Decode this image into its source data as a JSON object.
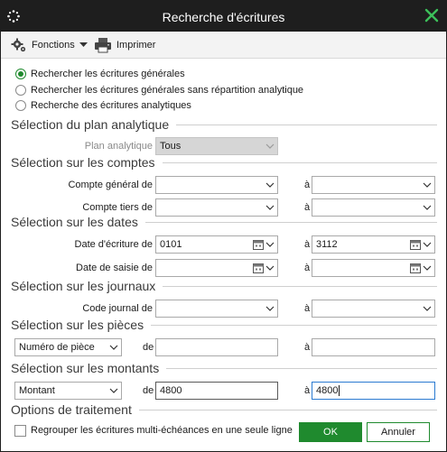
{
  "window": {
    "title": "Recherche d'écritures",
    "app_icon": "dotted-circle-icon",
    "close_icon": "close-x-icon"
  },
  "toolbar": {
    "functions_label": "Fonctions",
    "functions_icon": "gear-icon",
    "print_label": "Imprimer",
    "print_icon": "printer-icon"
  },
  "search_mode": {
    "options": [
      "Rechercher les écritures générales",
      "Rechercher les écritures générales sans répartition analytique",
      "Recherche des écritures analytiques"
    ],
    "selected_index": 0
  },
  "plan": {
    "heading": "Sélection du plan analytique",
    "label": "Plan analytique",
    "value": "Tous"
  },
  "comptes": {
    "heading": "Sélection sur les comptes",
    "general_label": "Compte général de",
    "tiers_label": "Compte tiers de",
    "a_label": "à"
  },
  "dates": {
    "heading": "Sélection sur les dates",
    "ecriture_label": "Date d'écriture de",
    "ecriture_from": "0101",
    "ecriture_to": "3112",
    "saisie_label": "Date de saisie de",
    "a_label": "à"
  },
  "journaux": {
    "heading": "Sélection sur les journaux",
    "code_label": "Code journal de",
    "a_label": "à"
  },
  "pieces": {
    "heading": "Sélection sur les pièces",
    "type_value": "Numéro de pièce",
    "de_label": "de",
    "a_label": "à"
  },
  "montants": {
    "heading": "Sélection sur les montants",
    "type_value": "Montant",
    "de_label": "de",
    "from": "4800",
    "to": "4800",
    "a_label": "à"
  },
  "options": {
    "heading": "Options de traitement",
    "regroup_label": "Regrouper les écritures multi-échéances en une seule ligne",
    "regroup_checked": false
  },
  "buttons": {
    "ok": "OK",
    "cancel": "Annuler"
  },
  "colors": {
    "accent_green": "#1f8a2e",
    "titlebar": "#1e1e1e",
    "focus_blue": "#2a7ad1"
  }
}
